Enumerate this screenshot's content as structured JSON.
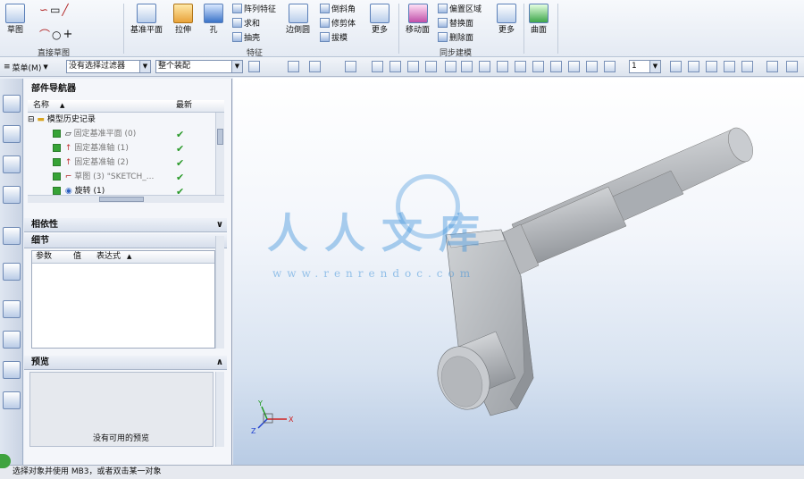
{
  "ribbon": {
    "sketch_label": "草图",
    "direct_sketch_group": "直接草图",
    "datum_plane_label": "基准平面",
    "extrude_label": "拉伸",
    "hole_label": "孔",
    "feature_group": "特征",
    "more_feature_label": "阵列特征",
    "combine_label": "求和",
    "shell_label": "抽壳",
    "edge_blend_label": "边倒圆",
    "chamfer_label": "倒斜角",
    "trim_body_label": "修剪体",
    "draft_label": "拔模",
    "more_label": "更多",
    "move_face_label": "移动面",
    "offset_region_label": "偏置区域",
    "replace_face_label": "替换面",
    "delete_face_label": "删除面",
    "sync_group": "同步建模",
    "more2_label": "更多",
    "surface_label": "曲面"
  },
  "toolbar": {
    "menu_label": "菜单(M)",
    "filter_value": "没有选择过滤器",
    "scope_value": "整个装配",
    "layer_value": "1"
  },
  "navigator": {
    "title": "部件导航器",
    "col_name": "名称",
    "col_latest": "最新",
    "root_label": "模型历史记录",
    "items": [
      {
        "label": "固定基准平面 (0)"
      },
      {
        "label": "固定基准轴 (1)"
      },
      {
        "label": "固定基准轴 (2)"
      },
      {
        "label": "草图 (3) \"SKETCH_..."
      },
      {
        "label": "旋转 (1)"
      }
    ],
    "dependencies_title": "相依性",
    "details_title": "细节",
    "details_cols": [
      "参数",
      "值",
      "表达式"
    ],
    "preview_title": "预览",
    "preview_empty": "没有可用的预览"
  },
  "viewport": {
    "watermark_text": "人人文库",
    "watermark_url": "www.renrendoc.com",
    "triad_x": "X",
    "triad_y": "Y",
    "triad_z": "Z"
  },
  "status": {
    "message": "选择对象并使用 MB3，或者双击某一对象"
  },
  "colors": {
    "accent": "#3a8fd9",
    "ribbon_bg": "#e4eaf3",
    "check_green": "#2a9a2a",
    "part_gray": "#b9bcc0"
  }
}
